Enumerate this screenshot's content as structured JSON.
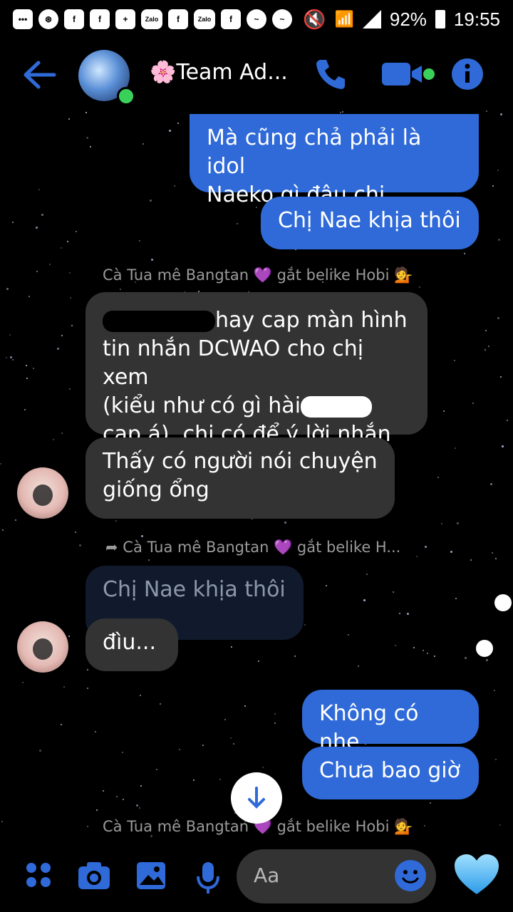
{
  "status_bar": {
    "battery": "92%",
    "time": "19:55",
    "left_icons": [
      "message-icon",
      "steering-icon",
      "facebook-icon",
      "facebook-icon",
      "add-user-icon",
      "zalo-icon",
      "facebook-icon",
      "zalo-icon",
      "facebook-icon",
      "messenger-icon",
      "messenger-icon"
    ],
    "zalo_label": "Zalo",
    "fb_label": "f"
  },
  "header": {
    "title": "🌸Team Ad...",
    "icons": [
      "back-arrow-icon",
      "avatar",
      "phone-icon",
      "video-call-icon",
      "info-icon"
    ]
  },
  "messages": [
    {
      "kind": "outgoing",
      "text_lines": [
        "Mà cũng chả phải là idol",
        "Naeko gì đâu chị"
      ]
    },
    {
      "kind": "outgoing",
      "text": "Chị Nae khịa thôi"
    },
    {
      "kind": "meta",
      "text": "Cà Tua mê Bangtan 💜 gắt belike Hobi 💁"
    },
    {
      "kind": "incoming",
      "line1_tail": "hay cap màn hình",
      "line2": "tin nhắn DCWAO cho chị xem",
      "line3_head": "(kiểu như có gì hài",
      "line4": "cap á), chị có để ý lời nhắn"
    },
    {
      "kind": "incoming",
      "text_lines": [
        "Thấy có người nói chuyện",
        "giống ổng"
      ]
    },
    {
      "kind": "meta_reply",
      "text": "Cà Tua mê Bangtan 💜 gắt belike H..."
    },
    {
      "kind": "quoted",
      "text": "Chị Nae khịa thôi"
    },
    {
      "kind": "incoming",
      "text": "đìu..."
    },
    {
      "kind": "outgoing",
      "text": "Không có nhe"
    },
    {
      "kind": "outgoing",
      "text": "Chưa bao giờ"
    },
    {
      "kind": "meta",
      "text": "Cà Tua mê Bangtan 💜 gắt belike Hobi 💁"
    }
  ],
  "composer": {
    "placeholder": "Aa",
    "icons": [
      "menu-grid-icon",
      "camera-icon",
      "image-icon",
      "microphone-icon",
      "emoji-icon",
      "heart-like-icon"
    ]
  },
  "colors": {
    "accent": "#2f6ad8",
    "incoming": "#333333",
    "background": "#000000"
  }
}
